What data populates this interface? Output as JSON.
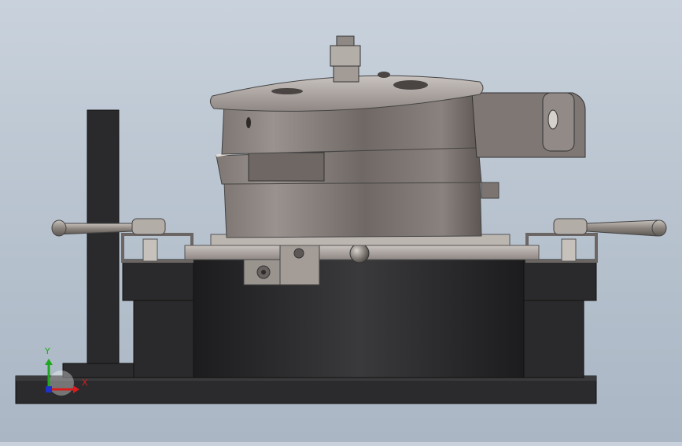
{
  "viewport": {
    "background_top": "#c9d2dc",
    "background_bottom": "#aab6c4"
  },
  "triad": {
    "x_label": "X",
    "y_label": "Y",
    "x_color": "#d81c1c",
    "y_color": "#1fa81f",
    "z_color": "#2030c8"
  },
  "model": {
    "body_color": "#2a2a2c",
    "metal_color": "#8f8783",
    "plate_color": "#bdb7b3"
  }
}
